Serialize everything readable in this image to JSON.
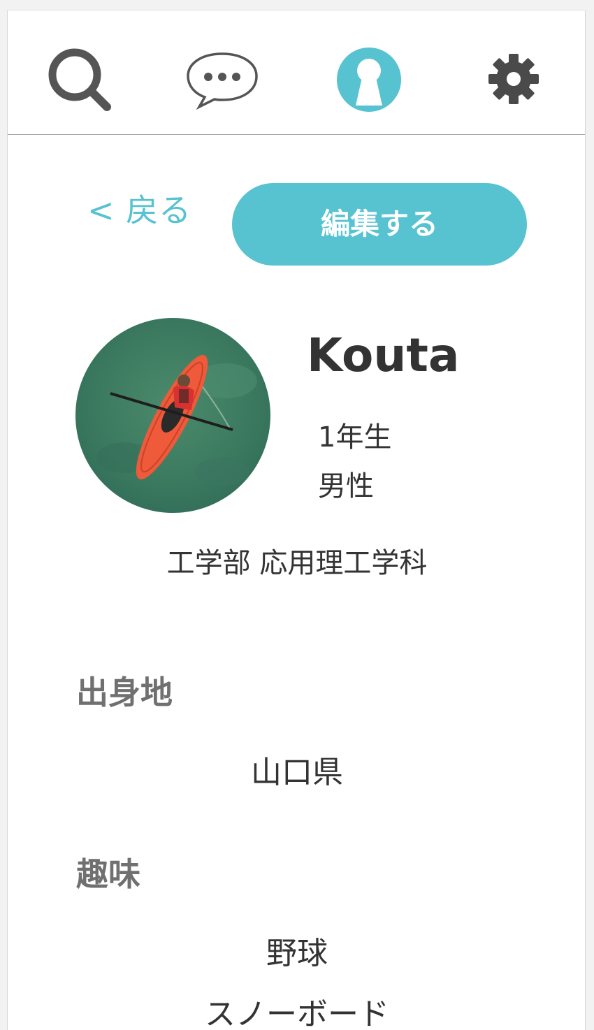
{
  "nav": {
    "icons": [
      "search-icon",
      "chat-icon",
      "profile-icon",
      "gear-icon"
    ],
    "active": "profile-icon"
  },
  "colors": {
    "accent": "#57c2d0",
    "heading": "#707070",
    "text": "#333333",
    "icon": "#555555"
  },
  "header": {
    "back_label": "< 戻る",
    "edit_label": "編集する"
  },
  "profile": {
    "name": "Kouta",
    "grade": "1年生",
    "gender": "男性",
    "department": "工学部 応用理工学科"
  },
  "sections": {
    "hometown": {
      "heading": "出身地",
      "value": "山口県"
    },
    "hobbies": {
      "heading": "趣味",
      "items": [
        "野球",
        "スノーボード"
      ]
    }
  }
}
